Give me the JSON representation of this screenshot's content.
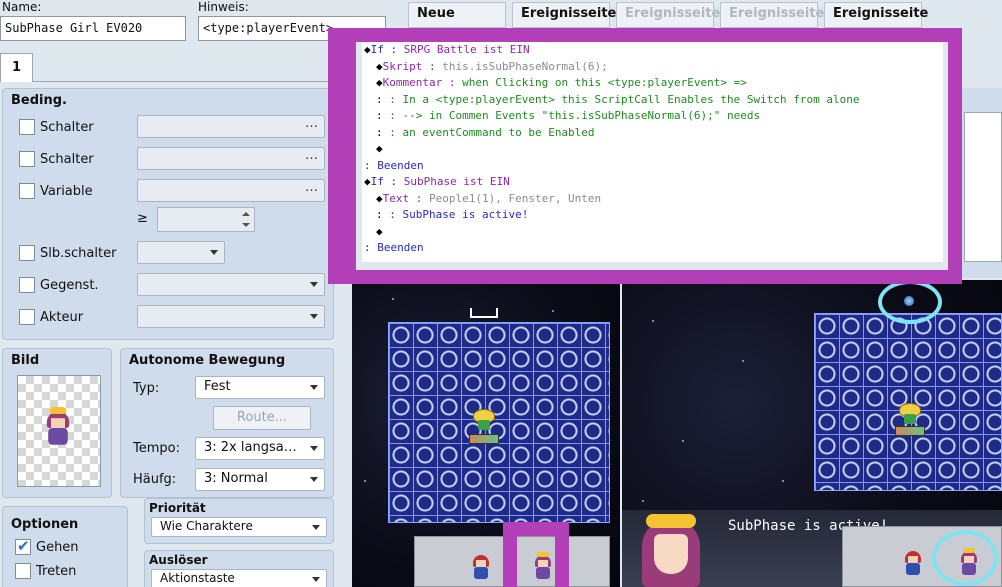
{
  "header": {
    "name_label": "Name:",
    "name_value": "SubPhase Girl EV020",
    "hint_label": "Hinweis:",
    "hint_value": "<type:playerEvent>",
    "buttons": [
      {
        "label": "Neue",
        "enabled": true
      },
      {
        "label": "Ereignisseite",
        "enabled": true
      },
      {
        "label": "Ereignisseite",
        "enabled": false
      },
      {
        "label": "Ereignisseite",
        "enabled": false
      },
      {
        "label": "Ereignisseite",
        "enabled": true
      }
    ],
    "page_tab": "1"
  },
  "conditions": {
    "title": "Beding.",
    "rows": [
      {
        "label": "Schalter",
        "checked": false
      },
      {
        "label": "Schalter",
        "checked": false
      },
      {
        "label": "Variable",
        "checked": false
      },
      {
        "label": "Slb.schalter",
        "checked": false
      },
      {
        "label": "Gegenst.",
        "checked": false
      },
      {
        "label": "Akteur",
        "checked": false
      }
    ],
    "compare_symbol": "≥",
    "ellipsis": "…"
  },
  "image": {
    "title": "Bild"
  },
  "autonomous": {
    "title": "Autonome Bewegung",
    "type_label": "Typ:",
    "type_value": "Fest",
    "route_label": "Route...",
    "speed_label": "Tempo:",
    "speed_value": "3: 2x langsa…",
    "freq_label": "Häufg:",
    "freq_value": "3: Normal"
  },
  "options": {
    "title": "Optionen",
    "items": [
      {
        "label": "Gehen",
        "checked": true
      },
      {
        "label": "Treten",
        "checked": false
      }
    ]
  },
  "priority": {
    "title": "Priorität",
    "value": "Wie Charaktere"
  },
  "trigger": {
    "title": "Auslöser",
    "value": "Aktionstaste"
  },
  "script": {
    "lines": [
      {
        "indent": 0,
        "bullet": true,
        "parts": [
          {
            "c": "blue",
            "t": "If : "
          },
          {
            "c": "purple",
            "t": "SRPG Battle ist EIN"
          }
        ]
      },
      {
        "indent": 1,
        "bullet": true,
        "parts": [
          {
            "c": "purple",
            "t": "Skript : "
          },
          {
            "c": "grey",
            "t": "this.isSubPhaseNormal(6);"
          }
        ]
      },
      {
        "indent": 1,
        "bullet": true,
        "parts": [
          {
            "c": "purple",
            "t": "Kommentar : "
          },
          {
            "c": "green",
            "t": "when Clicking on this <type:playerEvent> =>"
          }
        ]
      },
      {
        "indent": 1,
        "bullet": false,
        "parts": [
          {
            "c": "dia",
            "t": ":            "
          },
          {
            "c": "green",
            "t": ": In a <type:playerEvent> this ScriptCall Enables the Switch from alone"
          }
        ]
      },
      {
        "indent": 1,
        "bullet": false,
        "parts": [
          {
            "c": "dia",
            "t": ":            "
          },
          {
            "c": "green",
            "t": ": --> in Commen Events \"this.isSubPhaseNormal(6);\" needs"
          }
        ]
      },
      {
        "indent": 1,
        "bullet": false,
        "parts": [
          {
            "c": "dia",
            "t": ":            "
          },
          {
            "c": "green",
            "t": ": an eventCommand to be Enabled"
          }
        ]
      },
      {
        "indent": 1,
        "bullet": true,
        "parts": []
      },
      {
        "indent": 0,
        "bullet": false,
        "parts": [
          {
            "c": "blue",
            "t": ": Beenden"
          }
        ]
      },
      {
        "indent": 0,
        "bullet": true,
        "parts": [
          {
            "c": "blue",
            "t": "If : "
          },
          {
            "c": "purple",
            "t": "SubPhase  ist EIN"
          }
        ]
      },
      {
        "indent": 1,
        "bullet": true,
        "parts": [
          {
            "c": "purple",
            "t": "Text : "
          },
          {
            "c": "grey",
            "t": "People1(1), Fenster, Unten"
          }
        ]
      },
      {
        "indent": 1,
        "bullet": false,
        "parts": [
          {
            "c": "dia",
            "t": ":      "
          },
          {
            "c": "blue",
            "t": ": SubPhase is active!"
          }
        ]
      },
      {
        "indent": 1,
        "bullet": true,
        "parts": []
      },
      {
        "indent": 0,
        "bullet": false,
        "parts": [
          {
            "c": "blue",
            "t": ": Beenden"
          }
        ]
      }
    ]
  },
  "game": {
    "message": "SubPhase is active!"
  },
  "colors": {
    "highlight_frame": "#b23fb8",
    "highlight_ring": "#7fe3f0"
  }
}
